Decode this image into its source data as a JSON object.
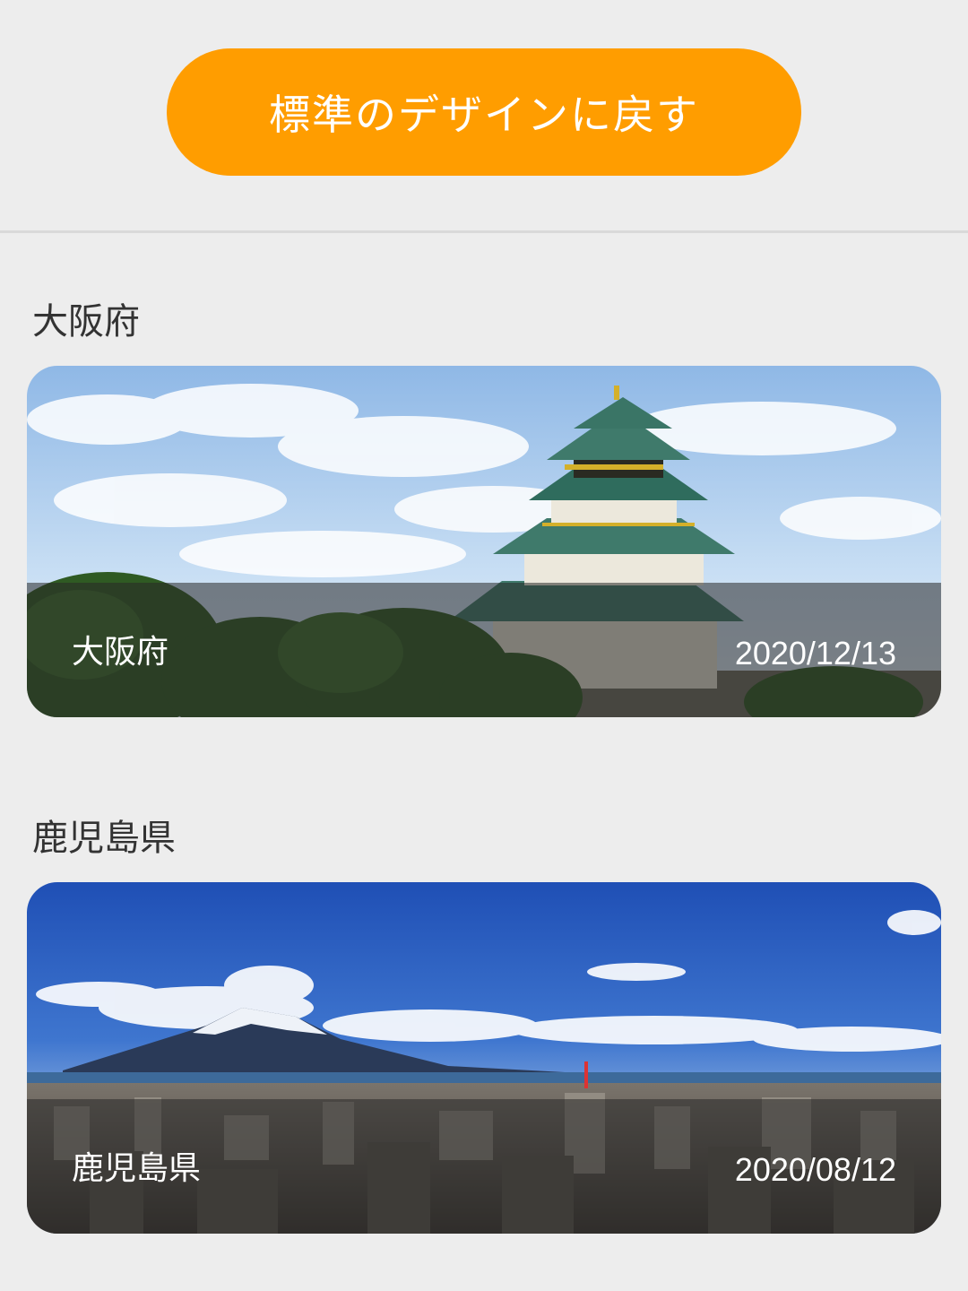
{
  "header": {
    "reset_button_label": "標準のデザインに戻す"
  },
  "sections": [
    {
      "title": "大阪府",
      "card": {
        "label": "大阪府",
        "date": "2020/12/13",
        "image": "osaka-castle-photo"
      }
    },
    {
      "title": "鹿児島県",
      "card": {
        "label": "鹿児島県",
        "date": "2020/08/12",
        "image": "sakurajima-city-photo"
      }
    }
  ],
  "colors": {
    "accent": "#ff9d00",
    "background": "#ededed"
  }
}
